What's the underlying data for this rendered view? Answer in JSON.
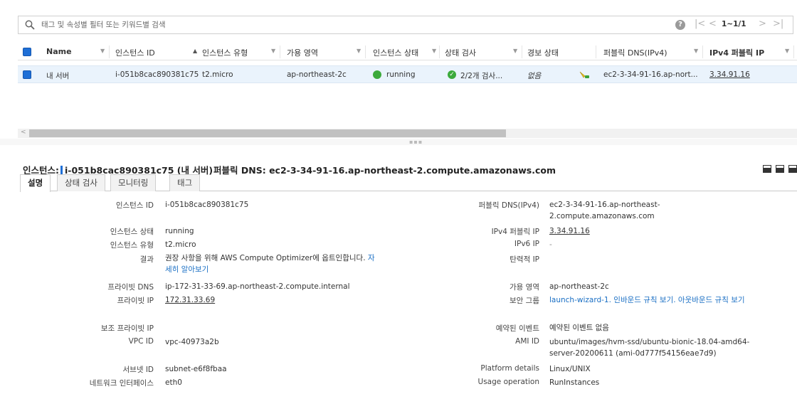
{
  "search": {
    "placeholder": "태그 및 속성별 필터 또는 키워드별 검색",
    "help": "?",
    "first": "|<",
    "prev": "<",
    "range": "1~1/1",
    "next": ">",
    "last": ">|"
  },
  "table": {
    "headers": {
      "name": "Name",
      "instance_id": "인스턴스 ID",
      "instance_type": "인스턴스 유형",
      "az": "가용 영역",
      "state": "인스턴스 상태",
      "status_check": "상태 검사",
      "alarm": "경보 상태",
      "public_dns": "퍼블릭 DNS(IPv4)",
      "public_ip": "IPv4 퍼블릭 IP"
    },
    "row": {
      "name": "내 서버",
      "instance_id": "i-051b8cac890381c75",
      "instance_type": "t2.micro",
      "az": "ap-northeast-2c",
      "state": "running",
      "status_check": "2/2개 검사...",
      "alarm": "없음",
      "public_dns": "ec2-3-34-91-16.ap-nort...",
      "public_ip": "3.34.91.16"
    }
  },
  "detail": {
    "title_label": "인스턴스:",
    "title_value": "i-051b8cac890381c75 (내 서버)",
    "dns_label": "퍼블릭 DNS:",
    "dns_value": "ec2-3-34-91-16.ap-northeast-2.compute.amazonaws.com",
    "tabs": [
      "설명",
      "상태 검사",
      "모니터링",
      "태그"
    ],
    "left": {
      "instance_id_label": "인스턴스 ID",
      "instance_id": "i-051b8cac890381c75",
      "state_label": "인스턴스 상태",
      "state": "running",
      "type_label": "인스턴스 유형",
      "type": "t2.micro",
      "finding_label": "결과",
      "finding_text": "권장 사항을 위해 AWS Compute Optimizer에 옵트인합니다.",
      "finding_link": "자세히 알아보기",
      "private_dns_label": "프라이빗 DNS",
      "private_dns": "ip-172-31-33-69.ap-northeast-2.compute.internal",
      "private_ip_label": "프라이빗 IP",
      "private_ip": "172.31.33.69",
      "secondary_ip_label": "보조 프라이빗 IP",
      "vpc_label": "VPC ID",
      "vpc": "vpc-40973a2b",
      "subnet_label": "서브넷 ID",
      "subnet": "subnet-e6f8fbaa",
      "nic_label": "네트워크 인터페이스",
      "nic": "eth0"
    },
    "right": {
      "public_dns_label": "퍼블릭 DNS(IPv4)",
      "public_dns": "ec2-3-34-91-16.ap-northeast-2.compute.amazonaws.com",
      "public_ip_label": "IPv4 퍼블릭 IP",
      "public_ip": "3.34.91.16",
      "ipv6_label": "IPv6 IP",
      "ipv6": "-",
      "elastic_ip_label": "탄력적 IP",
      "az_label": "가용 영역",
      "az": "ap-northeast-2c",
      "sg_label": "보안 그룹",
      "sg_name": "launch-wizard-1.",
      "sg_inbound": "인바운드 규칙 보기.",
      "sg_outbound": "아웃바운드 규칙 보기",
      "events_label": "예약된 이벤트",
      "events": "예약된 이벤트 없음",
      "ami_label": "AMI ID",
      "ami": "ubuntu/images/hvm-ssd/ubuntu-bionic-18.04-amd64-server-20200611 (ami-0d777f54156eae7d9)",
      "platform_label": "Platform details",
      "platform": "Linux/UNIX",
      "usage_label": "Usage operation",
      "usage": "RunInstances"
    }
  },
  "colors": {
    "accent": "#1f6fd6",
    "link": "#1a6fc4",
    "running": "#3caa3c",
    "row_selected": "#eaf3fc"
  }
}
